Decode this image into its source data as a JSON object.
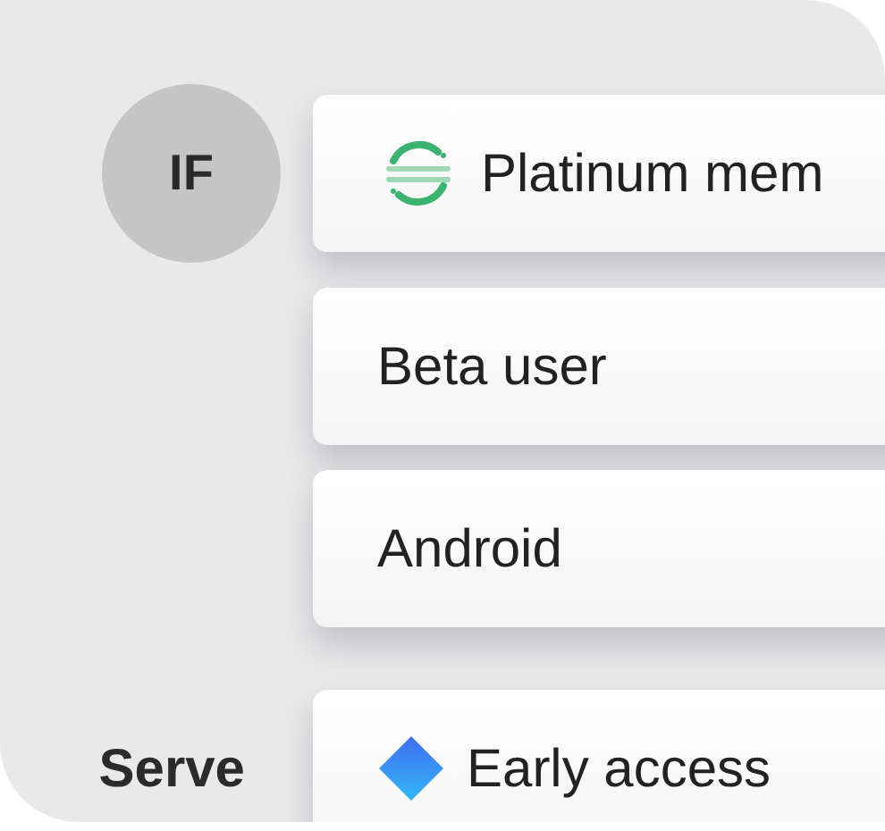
{
  "groups": [
    {
      "kind": "avatar",
      "label": "IF",
      "items": [
        {
          "kind": "logo",
          "text": "Platinum mem"
        },
        {
          "kind": "plain",
          "text": "Beta user"
        },
        {
          "kind": "plain",
          "text": "Android"
        }
      ]
    },
    {
      "kind": "heading",
      "label": "Serve",
      "items": [
        {
          "kind": "diamond",
          "text": "Early access"
        }
      ]
    }
  ]
}
